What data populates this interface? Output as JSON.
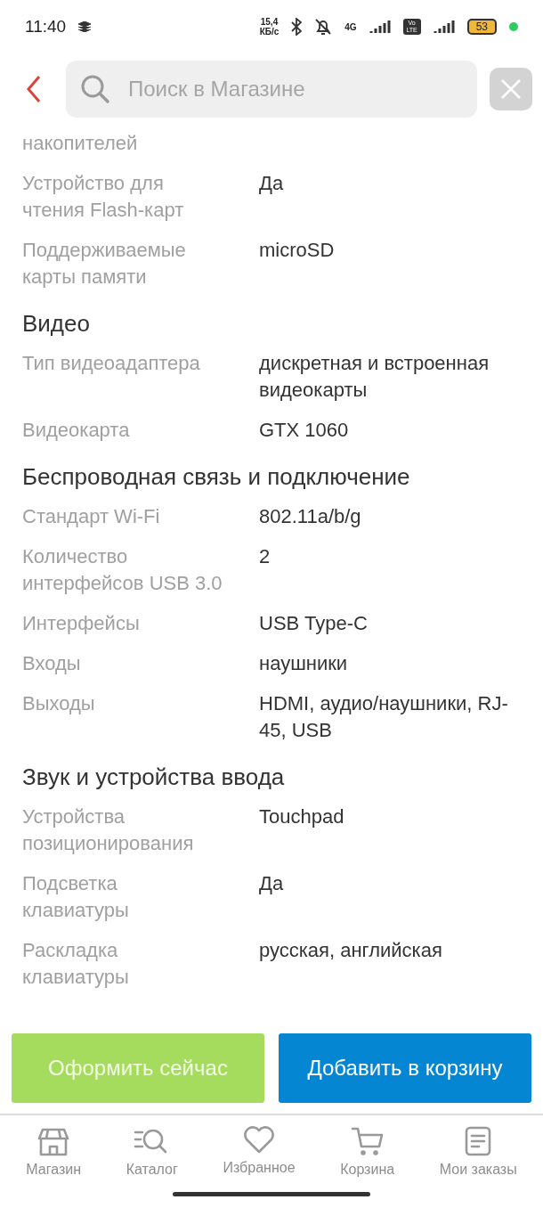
{
  "status_bar": {
    "time": "11:40",
    "speed": "15,4",
    "speed_unit": "КБ/с",
    "network": "4G",
    "volte": "Vo LTE",
    "battery": "53"
  },
  "search": {
    "placeholder": "Поиск в Магазине"
  },
  "sections": [
    {
      "rows": [
        {
          "label": "накопителей"
        },
        {
          "label": "Устройство для чтения Flash-карт",
          "value": "Да"
        },
        {
          "label": "Поддерживаемые карты памяти",
          "value": "microSD"
        }
      ]
    },
    {
      "title": "Видео",
      "rows": [
        {
          "label": "Тип видеоадаптера",
          "value": "дискретная и встроенная видеокарты"
        },
        {
          "label": "Видеокарта",
          "value": "GTX 1060"
        }
      ]
    },
    {
      "title": "Беспроводная связь и подключение",
      "rows": [
        {
          "label": "Стандарт Wi-Fi",
          "value": "802.11a/b/g"
        },
        {
          "label": "Количество интерфейсов USB 3.0",
          "value": "2"
        },
        {
          "label": "Интерфейсы",
          "value": "USB Type-C"
        },
        {
          "label": "Входы",
          "value": "наушники"
        },
        {
          "label": "Выходы",
          "value": "HDMI, аудио/наушники, RJ-45, USB"
        }
      ]
    },
    {
      "title": "Звук и устройства ввода",
      "rows": [
        {
          "label": "Устройства позиционирования",
          "value": "Touchpad"
        },
        {
          "label": "Подсветка клавиатуры",
          "value": "Да"
        },
        {
          "label": "Раскладка клавиатуры",
          "value": "русская, английская"
        }
      ]
    }
  ],
  "actions": [
    {
      "label": "Оформить сейчас",
      "kind": "checkout"
    },
    {
      "label": "Добавить в корзину",
      "kind": "cart"
    }
  ],
  "nav": [
    {
      "label": "Магазин",
      "kind": "store"
    },
    {
      "label": "Каталог",
      "kind": "catalog"
    },
    {
      "label": "Избранное",
      "kind": "favorites"
    },
    {
      "label": "Корзина",
      "kind": "cart"
    },
    {
      "label": "Мои заказы",
      "kind": "orders"
    }
  ]
}
